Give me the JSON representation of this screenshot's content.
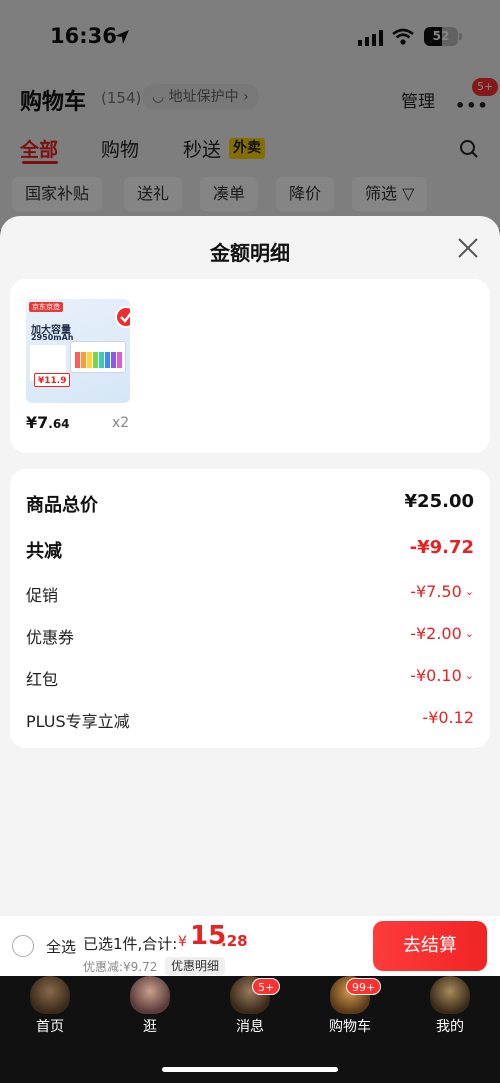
{
  "status_bar": {
    "time": "16:36",
    "battery": "52"
  },
  "header": {
    "title": "购物车",
    "count": "(154)",
    "address_chip": "地址保护中",
    "manage": "管理",
    "more_badge": "5+"
  },
  "tabs": [
    {
      "label": "全部",
      "active": true
    },
    {
      "label": "购物"
    },
    {
      "label": "秒送"
    }
  ],
  "waimai_tag": "外卖",
  "filters": [
    "国家补贴",
    "送礼",
    "凑单",
    "降价",
    "筛选"
  ],
  "sheet": {
    "title": "金额明细",
    "product": {
      "brand_tag": "京东京造",
      "image_headline": "加大容量",
      "image_capacity": "2950mAh",
      "image_price": "¥11.9",
      "price_int": "¥7",
      "price_dec": ".64",
      "qty": "x2"
    },
    "breakdown": [
      {
        "label": "商品总价",
        "value": "¥25.00",
        "style": "big total"
      },
      {
        "label": "共减",
        "value": "-¥9.72",
        "style": "big"
      },
      {
        "label": "促销",
        "value": "-¥7.50",
        "caret": true
      },
      {
        "label": "优惠券",
        "value": "-¥2.00",
        "caret": true
      },
      {
        "label": "红包",
        "value": "-¥0.10",
        "caret": true
      },
      {
        "label": "PLUS专享立减",
        "value": "-¥0.12"
      }
    ]
  },
  "checkout": {
    "select_all": "全选",
    "summary": "已选1件,合计:",
    "currency": "¥",
    "total_int": "15",
    "total_dec": ".28",
    "discount_note": "优惠减:¥9.72",
    "detail_chip": "优惠明细",
    "checkout_button": "去结算"
  },
  "bottom_nav": [
    {
      "label": "首页"
    },
    {
      "label": "逛"
    },
    {
      "label": "消息",
      "badge": "5+"
    },
    {
      "label": "购物车",
      "badge": "99+"
    },
    {
      "label": "我的"
    }
  ]
}
